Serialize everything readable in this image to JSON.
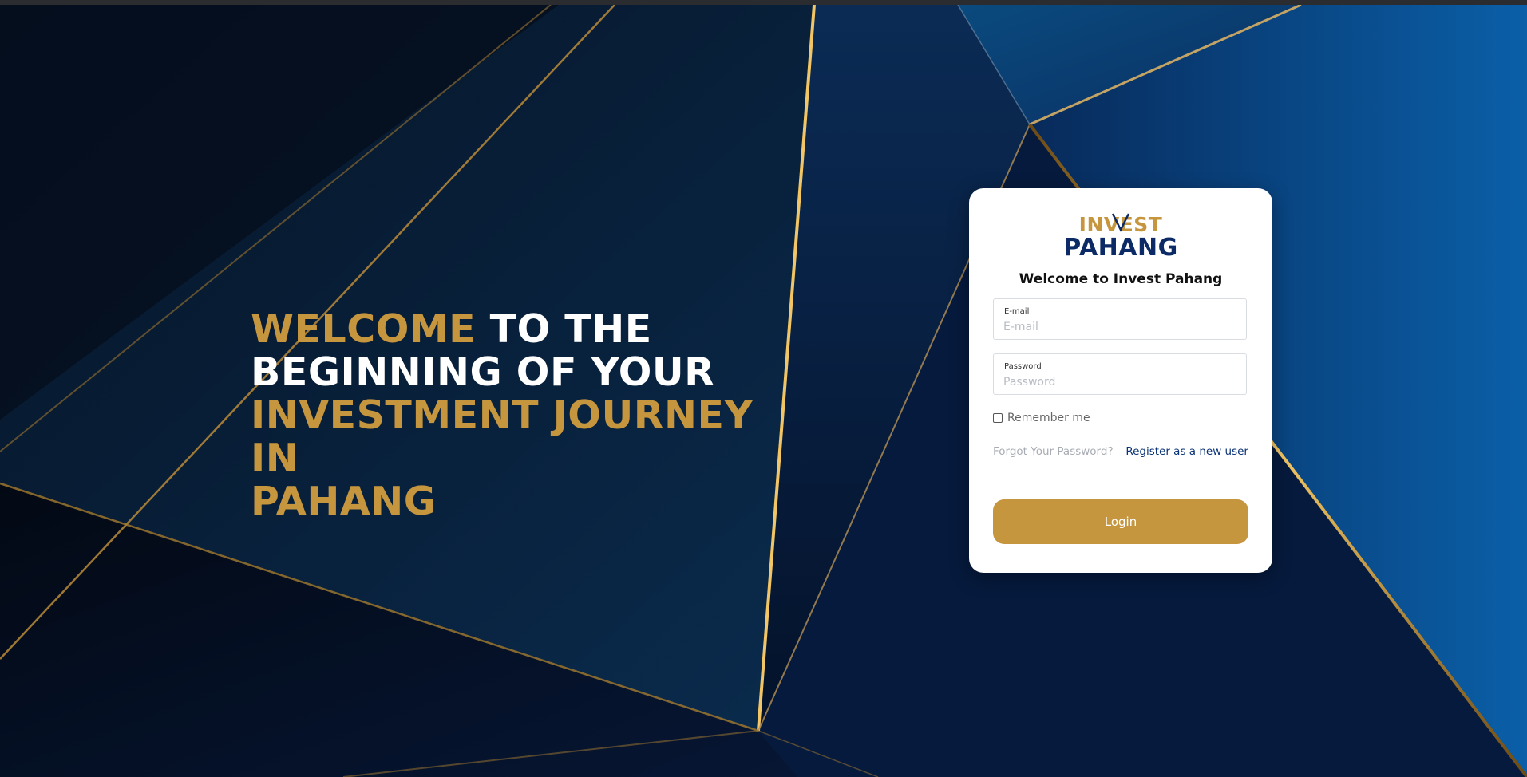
{
  "hero": {
    "line1_gold": "WELCOME",
    "line1_white": " TO THE",
    "line2_white": "BEGINNING OF YOUR",
    "line3_gold": "INVESTMENT JOURNEY IN",
    "line4_gold": "PAHANG"
  },
  "logo": {
    "top_word": "INVEST",
    "bottom_word": "PAHANG"
  },
  "login_card": {
    "title": "Welcome to Invest Pahang",
    "email_label": "E-mail",
    "email_placeholder": "E-mail",
    "email_value": "",
    "password_label": "Password",
    "password_placeholder": "Password",
    "password_value": "",
    "remember_label": "Remember me",
    "remember_checked": false,
    "forgot_link": "Forgot Your Password?",
    "register_link": "Register as a new user",
    "login_button": "Login"
  },
  "colors": {
    "gold": "#c6963f",
    "navy": "#0b3377",
    "background": "#050a18"
  }
}
